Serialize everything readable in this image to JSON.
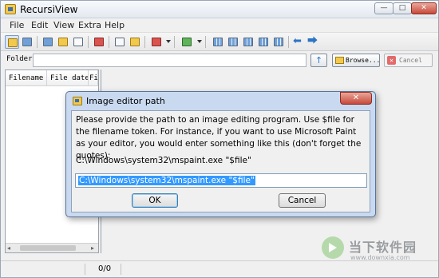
{
  "window": {
    "title": "RecursiView",
    "min_glyph": "—",
    "max_glyph": "□",
    "close_glyph": "✕"
  },
  "menu": {
    "items": [
      "File",
      "Edit",
      "View",
      "Extra",
      "Help"
    ]
  },
  "toolbar": {
    "icons": [
      "folder-tree-icon",
      "folder-sync-icon",
      "image-list-icon",
      "stack-icon",
      "gallery-icon",
      "monitor-icon",
      "copy-icon",
      "paste-icon",
      "burn-icon",
      "filter-icon",
      "grid-1-icon",
      "grid-2-icon",
      "grid-3-icon",
      "grid-4-icon"
    ],
    "back_glyph": "⬅",
    "forward_glyph": "⮕"
  },
  "folderbar": {
    "label": "Folder",
    "value": "",
    "up_glyph": "↑",
    "browse_label": "Browse...",
    "cancel_label": "Cancel",
    "cancel_glyph": "✕"
  },
  "file_list": {
    "columns": [
      "Filename",
      "File date",
      "Fi"
    ]
  },
  "scroll": {
    "left_glyph": "◂",
    "right_glyph": "▸"
  },
  "statusbar": {
    "count": "0/0"
  },
  "dialog": {
    "title": "Image editor path",
    "close_glyph": "✕",
    "message": "Please provide the path to an image editing program.  Use $file for the filename token.  For instance, if you want to use Microsoft Paint as your editor, you would enter something like this (don't forget the quotes):",
    "example": "C:\\Windows\\system32\\mspaint.exe \"$file\"",
    "input_value": "C:\\Windows\\system32\\mspaint.exe \"$file\"",
    "ok_label": "OK",
    "cancel_label": "Cancel"
  },
  "watermark": {
    "text": "当下软件园",
    "url": "www.downxia.com"
  },
  "colors": {
    "dialog_frame": "#c9daf0",
    "selection": "#3399ff",
    "close_red": "#c7493a"
  }
}
